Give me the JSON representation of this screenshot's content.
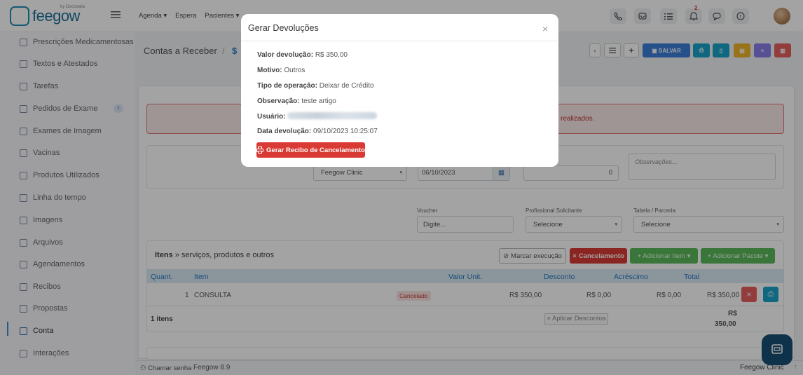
{
  "brand": {
    "name": "feegow",
    "tagline": "by Doctoralia"
  },
  "topnav": [
    "Agenda ▾",
    "Espera",
    "Pacientes ▾"
  ],
  "notification_count": "2",
  "sidebar": {
    "items": [
      {
        "label": "Prescrições Medicamentosas",
        "icon": "pill-icon"
      },
      {
        "label": "Textos e Atestados",
        "icon": "document-icon"
      },
      {
        "label": "Tarefas",
        "icon": "list-icon"
      },
      {
        "label": "Pedidos de Exame",
        "icon": "clipboard-icon",
        "badge": "1"
      },
      {
        "label": "Exames de Imagem",
        "icon": "image-exam-icon"
      },
      {
        "label": "Vacinas",
        "icon": "syringe-icon"
      },
      {
        "label": "Produtos Utilizados",
        "icon": "box-icon"
      },
      {
        "label": "Linha do tempo",
        "icon": "timeline-icon"
      },
      {
        "label": "Imagens",
        "icon": "camera-icon"
      },
      {
        "label": "Arquivos",
        "icon": "file-icon"
      },
      {
        "label": "Agendamentos",
        "icon": "calendar-icon"
      },
      {
        "label": "Recibos",
        "icon": "receipt-icon"
      },
      {
        "label": "Propostas",
        "icon": "copy-icon"
      },
      {
        "label": "Conta",
        "icon": "account-icon"
      },
      {
        "label": "Interações",
        "icon": "link-icon"
      }
    ],
    "active": "Conta"
  },
  "page": {
    "breadcrumb_title": "Contas a Receber",
    "breadcrumb_sep": "/",
    "breadcrumb_sub": "$",
    "save_label": "SALVAR",
    "alert_text": "realizados."
  },
  "form": {
    "unit_value": "Feegow Clinic",
    "date_value": "06/10/2023",
    "amount_value": "0",
    "notes_placeholder": "Observações...",
    "voucher_label": "Voucher",
    "voucher_placeholder": "Digite...",
    "requesting_label": "Profissional Solicitante",
    "requesting_value": "Selecione",
    "table_label": "Tabela / Parceria",
    "table_value": "Selecione"
  },
  "items": {
    "title_bold": "Itens",
    "title_rest": "» serviços, produtos e outros",
    "buttons": {
      "mark": "Marcar execução",
      "cancel": "Cancelamento",
      "add_item": "+ Adicionar Item ▾",
      "add_package": "+ Adicionar Pacote ▾"
    },
    "columns": [
      "Quant.",
      "Item",
      "Valor Unit.",
      "Desconto",
      "Acréscimo",
      "Total"
    ],
    "row": {
      "qty": "1",
      "item": "CONSULTA",
      "status": "Cancelado",
      "unit": "R$ 350,00",
      "discount": "R$ 0,00",
      "addition": "R$ 0,00",
      "total": "R$ 350,00"
    },
    "footer_count": "1 itens",
    "apply_discounts": "Aplicar Descontos",
    "footer_total_currency": "R$",
    "footer_total_value": "350,00"
  },
  "footer": {
    "call_password": "Chamar senha",
    "version": "Feegow 8.9",
    "clinic": "Feegow Clinic"
  },
  "modal": {
    "title": "Gerar Devoluções",
    "close": "×",
    "rows": [
      {
        "label": "Valor devolução:",
        "value": "R$ 350,00"
      },
      {
        "label": "Motivo:",
        "value": "Outros"
      },
      {
        "label": "Tipo de operação:",
        "value": "Deixar de Crédito"
      },
      {
        "label": "Observação:",
        "value": "teste artigo"
      },
      {
        "label": "Usuário:",
        "value": ""
      },
      {
        "label": "Data devolução:",
        "value": "09/10/2023 10:25:07"
      }
    ],
    "button": "Gerar Recibo de Cancelamento"
  },
  "colors": {
    "primary": "#3b7dd8",
    "danger": "#d93b34",
    "success": "#5cb85c",
    "brand": "#1d6f9a"
  }
}
